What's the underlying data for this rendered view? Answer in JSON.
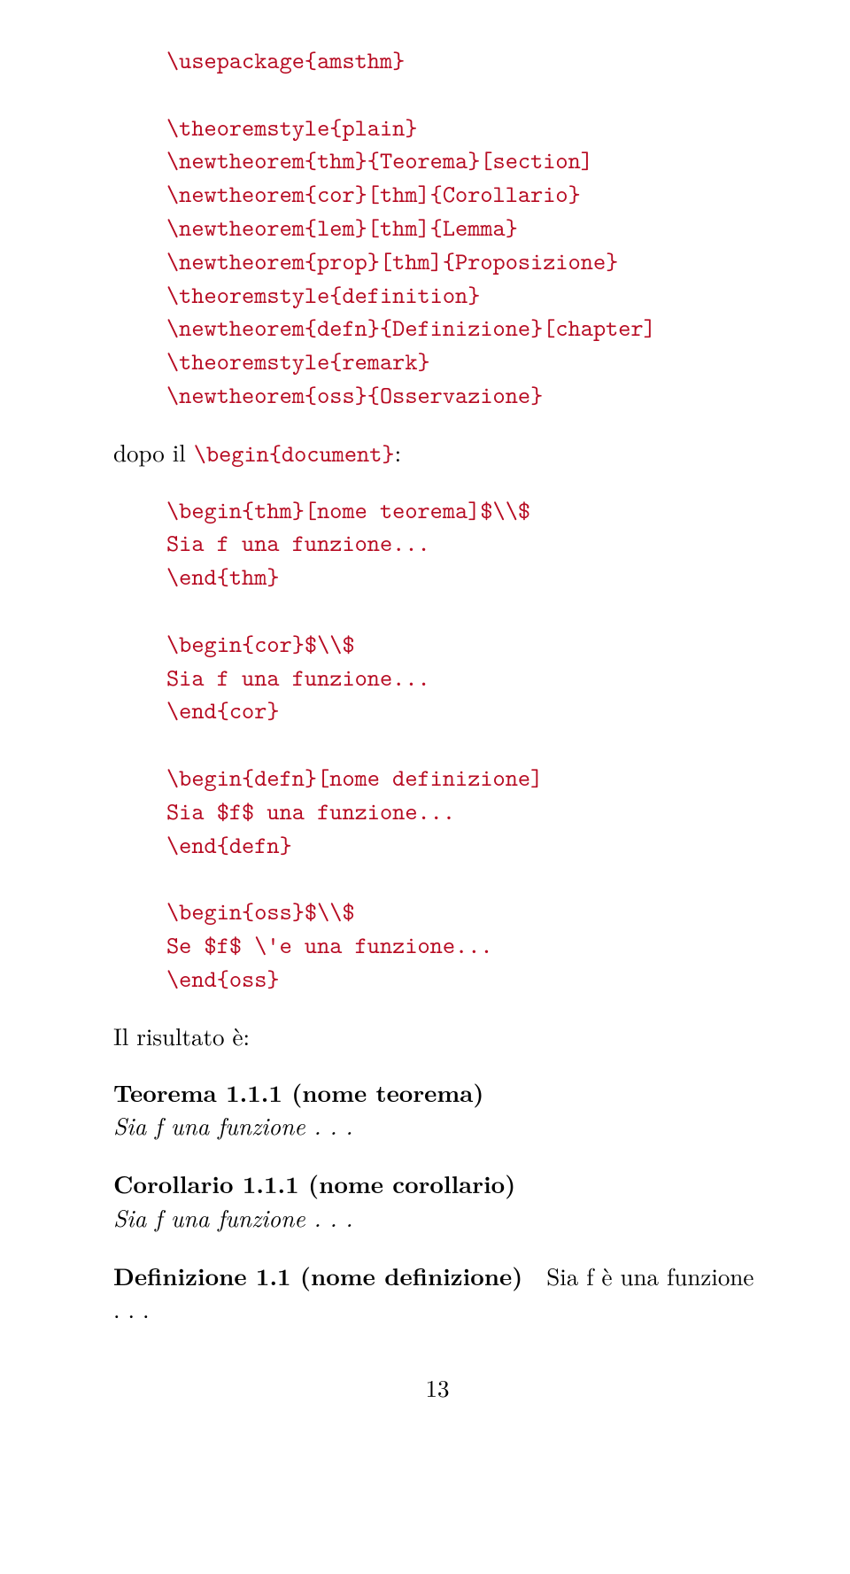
{
  "code_block_1": [
    "\\usepackage{amsthm}",
    "",
    "\\theoremstyle{plain}",
    "\\newtheorem{thm}{Teorema}[section]",
    "\\newtheorem{cor}[thm]{Corollario}",
    "\\newtheorem{lem}[thm]{Lemma}",
    "\\newtheorem{prop}[thm]{Proposizione}",
    "\\theoremstyle{definition}",
    "\\newtheorem{defn}{Definizione}[chapter]",
    "\\theoremstyle{remark}",
    "\\newtheorem{oss}{Osservazione}"
  ],
  "para_1_prefix": "dopo il ",
  "para_1_code": "\\begin{document}",
  "para_1_suffix": ":",
  "code_block_2": [
    "\\begin{thm}[nome teorema]$\\\\$",
    "Sia f una funzione...",
    "\\end{thm}",
    "",
    "\\begin{cor}$\\\\$",
    "Sia f una funzione...",
    "\\end{cor}",
    "",
    "\\begin{defn}[nome definizione]",
    "Sia $f$ una funzione...",
    "\\end{defn}",
    "",
    "\\begin{oss}$\\\\$",
    "Se $f$ \\'e una funzione...",
    "\\end{oss}"
  ],
  "para_2": "Il risultato è:",
  "thm_1_head": "Teorema 1.1.1 (nome teorema)",
  "thm_1_body": "Sia f una funzione . . .",
  "thm_2_head": "Corollario 1.1.1 (nome corollario)",
  "thm_2_body": "Sia f una funzione . . .",
  "defn_head": "Definizione 1.1 (nome definizione)",
  "defn_body": "Sia f è una funzione . . .",
  "page_number": "13"
}
